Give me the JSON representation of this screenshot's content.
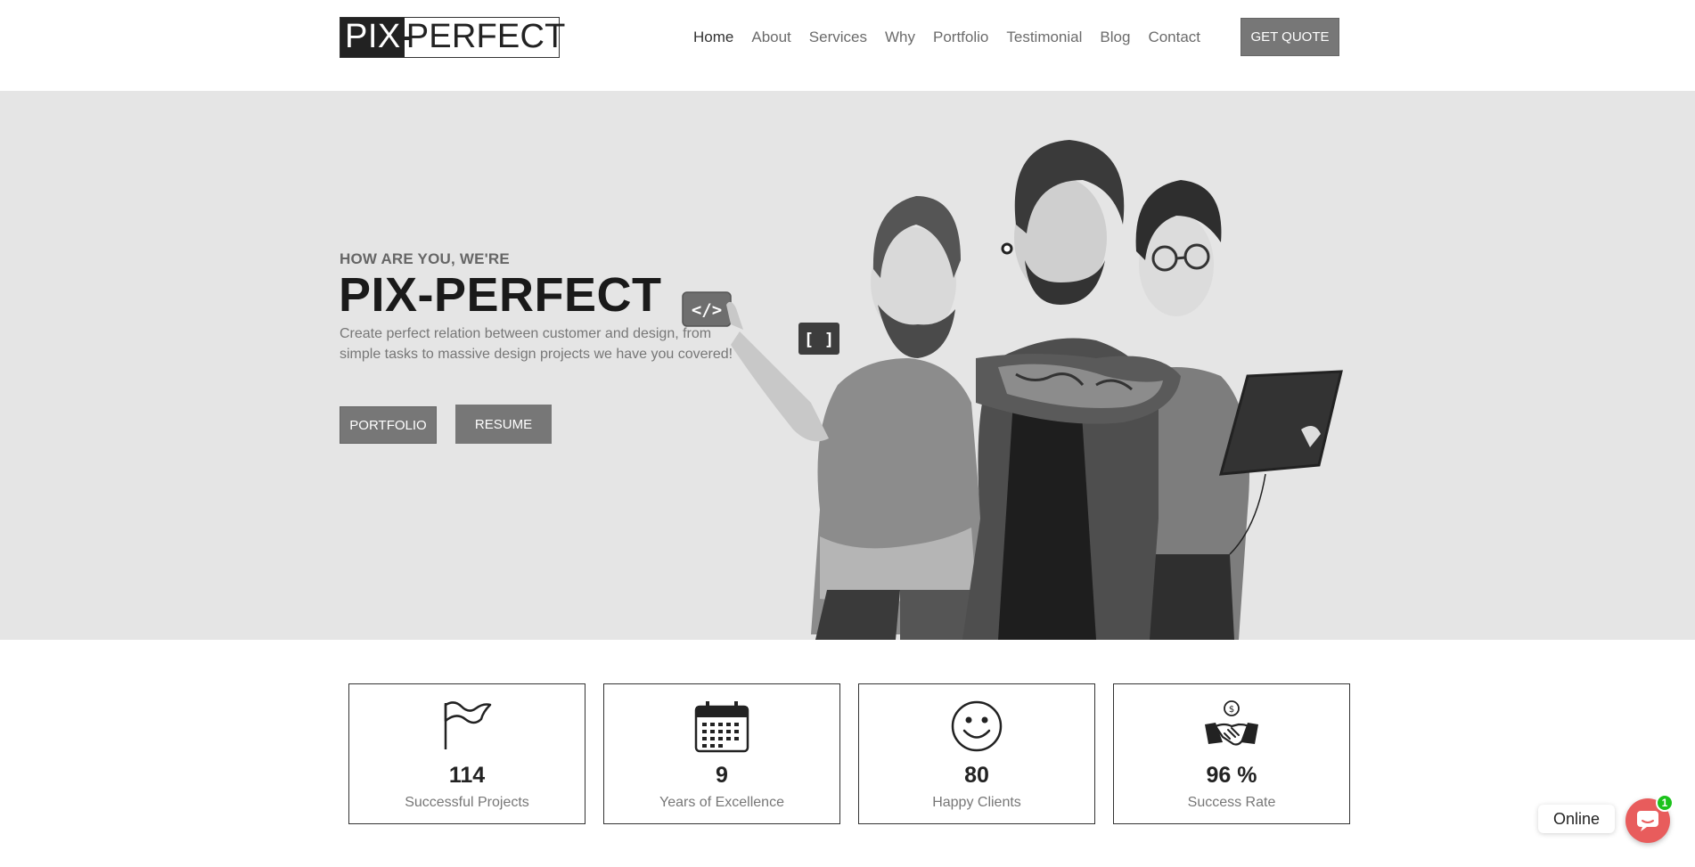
{
  "header": {
    "logo": {
      "left": "PIX",
      "right": "PERFECT"
    },
    "nav": [
      {
        "label": "Home"
      },
      {
        "label": "About"
      },
      {
        "label": "Services"
      },
      {
        "label": "Why"
      },
      {
        "label": "Portfolio"
      },
      {
        "label": "Testimonial"
      },
      {
        "label": "Blog"
      },
      {
        "label": "Contact"
      }
    ],
    "quote_button": "GET QUOTE"
  },
  "hero": {
    "eyebrow": "HOW ARE YOU, WE'RE",
    "title": "PIX-PERFECT",
    "description": "Create perfect relation between customer and design, from simple tasks to massive design projects we have you covered!",
    "portfolio_button": "PORTFOLIO",
    "resume_button": "RESUME",
    "illustration": {
      "code_badge": "</>",
      "bracket_badge": "[ ]"
    }
  },
  "stats": [
    {
      "icon": "flag-icon",
      "value": "114",
      "label": "Successful Projects"
    },
    {
      "icon": "calendar-icon",
      "value": "9",
      "label": "Years of Excellence"
    },
    {
      "icon": "smile-icon",
      "value": "80",
      "label": "Happy Clients"
    },
    {
      "icon": "handshake-icon",
      "value": "96 %",
      "label": "Success Rate"
    }
  ],
  "chat": {
    "status": "Online",
    "badge_count": "1"
  },
  "colors": {
    "hero_bg": "#e5e5e5",
    "button": "#777777",
    "chat": "#e85c5c",
    "badge": "#1bc21b"
  }
}
